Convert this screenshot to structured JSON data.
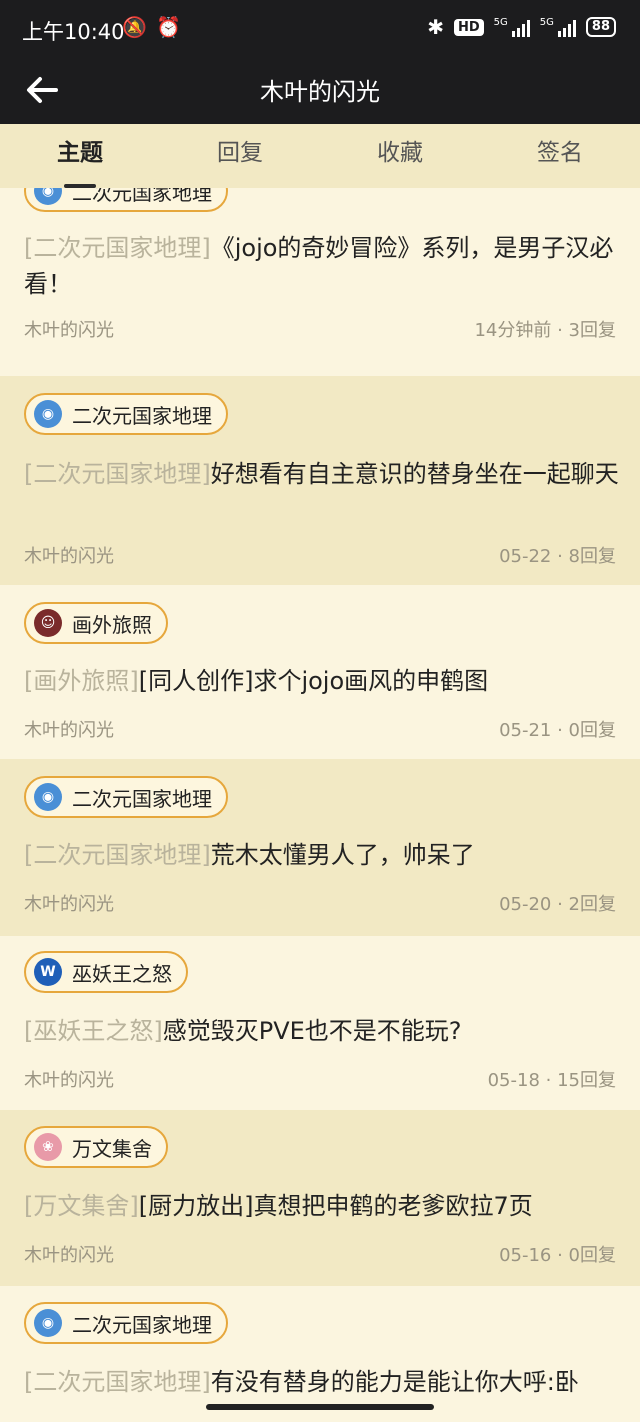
{
  "status": {
    "time": "上午10:40",
    "hd": "HD",
    "net1": "5G",
    "net2": "5G",
    "battery": "88"
  },
  "header": {
    "title": "木叶的闪光"
  },
  "tabs": [
    {
      "label": "主题"
    },
    {
      "label": "回复"
    },
    {
      "label": "收藏"
    },
    {
      "label": "签名"
    }
  ],
  "posts": [
    {
      "forum": "二次元国家地理",
      "prefix": "[二次元国家地理]",
      "title": "《jojo的奇妙冒险》系列，是男子汉必看！",
      "author": "木叶的闪光",
      "time": "14分钟前",
      "replies": "3回复",
      "icon": "globe-icon",
      "icon_color": "#4a8fd6"
    },
    {
      "forum": "二次元国家地理",
      "prefix": "[二次元国家地理]",
      "title": "好想看有自主意识的替身坐在一起聊天",
      "author": "木叶的闪光",
      "time": "05-22",
      "replies": "8回复",
      "icon": "globe-icon",
      "icon_color": "#4a8fd6"
    },
    {
      "forum": "画外旅照",
      "prefix": "[画外旅照]",
      "title": "[同人创作]求个jojo画风的申鹤图",
      "author": "木叶的闪光",
      "time": "05-21",
      "replies": "0回复",
      "icon": "character-icon",
      "icon_color": "#7a2b2b"
    },
    {
      "forum": "二次元国家地理",
      "prefix": "[二次元国家地理]",
      "title": "荒木太懂男人了，帅呆了",
      "author": "木叶的闪光",
      "time": "05-20",
      "replies": "2回复",
      "icon": "globe-icon",
      "icon_color": "#4a8fd6"
    },
    {
      "forum": "巫妖王之怒",
      "prefix": "[巫妖王之怒]",
      "title": "感觉毁灭PVE也不是不能玩?",
      "author": "木叶的闪光",
      "time": "05-18",
      "replies": "15回复",
      "icon": "wow-logo-icon",
      "icon_letter": "W",
      "icon_color": "#1f5fb8"
    },
    {
      "forum": "万文集舍",
      "prefix": "[万文集舍]",
      "title": "[厨力放出]真想把申鹤的老爹欧拉7页",
      "author": "木叶的闪光",
      "time": "05-16",
      "replies": "0回复",
      "icon": "anime-girl-icon",
      "icon_color": "#e89aa8"
    },
    {
      "forum": "二次元国家地理",
      "prefix": "[二次元国家地理]",
      "title": "有没有替身的能力是能让你大呼:卧",
      "author": "",
      "time": "",
      "replies": "",
      "icon": "globe-icon",
      "icon_color": "#4a8fd6"
    }
  ]
}
